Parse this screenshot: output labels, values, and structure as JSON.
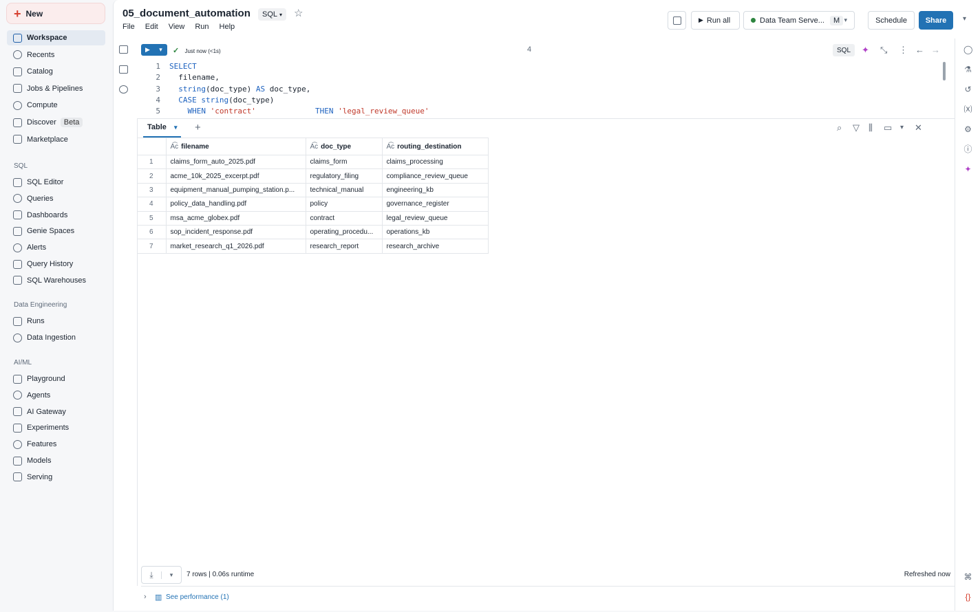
{
  "sidebar": {
    "new_label": "New",
    "items": [
      {
        "label": "Workspace",
        "icon": "workspace-icon",
        "active": true
      },
      {
        "label": "Recents",
        "icon": "clock-icon"
      },
      {
        "label": "Catalog",
        "icon": "catalog-icon"
      },
      {
        "label": "Jobs & Pipelines",
        "icon": "jobs-icon"
      },
      {
        "label": "Compute",
        "icon": "cloud-icon"
      },
      {
        "label": "Discover",
        "icon": "compass-icon",
        "badge": "Beta"
      },
      {
        "label": "Marketplace",
        "icon": "store-icon"
      }
    ],
    "sql_label": "SQL",
    "sql_items": [
      {
        "label": "SQL Editor"
      },
      {
        "label": "Queries"
      },
      {
        "label": "Dashboards"
      },
      {
        "label": "Genie Spaces"
      },
      {
        "label": "Alerts"
      },
      {
        "label": "Query History"
      },
      {
        "label": "SQL Warehouses"
      }
    ],
    "de_label": "Data Engineering",
    "de_items": [
      {
        "label": "Runs"
      },
      {
        "label": "Data Ingestion"
      }
    ],
    "ml_label": "AI/ML",
    "ml_items": [
      {
        "label": "Playground"
      },
      {
        "label": "Agents"
      },
      {
        "label": "AI Gateway"
      },
      {
        "label": "Experiments"
      },
      {
        "label": "Features"
      },
      {
        "label": "Models"
      },
      {
        "label": "Serving"
      }
    ]
  },
  "header": {
    "title": "05_document_automation",
    "language": "SQL",
    "menu": [
      "File",
      "Edit",
      "View",
      "Run",
      "Help"
    ],
    "run_all": "Run all",
    "compute_name": "Data Team Serve...",
    "compute_badge": "M",
    "schedule": "Schedule",
    "share": "Share"
  },
  "cell": {
    "status": "Just now (<1s)",
    "number": "4",
    "lang_tag": "SQL",
    "code_lines": [
      {
        "n": "1",
        "parts": [
          {
            "t": "SELECT",
            "c": "kw"
          }
        ]
      },
      {
        "n": "2",
        "parts": [
          {
            "t": "  filename,",
            "c": ""
          }
        ]
      },
      {
        "n": "3",
        "parts": [
          {
            "t": "  ",
            "c": ""
          },
          {
            "t": "string",
            "c": "kw"
          },
          {
            "t": "(doc_type) ",
            "c": ""
          },
          {
            "t": "AS",
            "c": "kw"
          },
          {
            "t": " doc_type,",
            "c": ""
          }
        ]
      },
      {
        "n": "4",
        "parts": [
          {
            "t": "  ",
            "c": ""
          },
          {
            "t": "CASE",
            "c": "kw"
          },
          {
            "t": " ",
            "c": ""
          },
          {
            "t": "string",
            "c": "kw"
          },
          {
            "t": "(doc_type)",
            "c": ""
          }
        ]
      },
      {
        "n": "5",
        "parts": [
          {
            "t": "    ",
            "c": ""
          },
          {
            "t": "WHEN",
            "c": "kw"
          },
          {
            "t": " ",
            "c": ""
          },
          {
            "t": "'contract'",
            "c": "str"
          },
          {
            "t": "             ",
            "c": ""
          },
          {
            "t": "THEN",
            "c": "kw"
          },
          {
            "t": " ",
            "c": ""
          },
          {
            "t": "'legal_review_queue'",
            "c": "str"
          }
        ]
      }
    ]
  },
  "results": {
    "tab_label": "Table",
    "columns": [
      "filename",
      "doc_type",
      "routing_destination"
    ],
    "rows": [
      [
        "1",
        "claims_form_auto_2025.pdf",
        "claims_form",
        "claims_processing"
      ],
      [
        "2",
        "acme_10k_2025_excerpt.pdf",
        "regulatory_filing",
        "compliance_review_queue"
      ],
      [
        "3",
        "equipment_manual_pumping_station.p...",
        "technical_manual",
        "engineering_kb"
      ],
      [
        "4",
        "policy_data_handling.pdf",
        "policy",
        "governance_register"
      ],
      [
        "5",
        "msa_acme_globex.pdf",
        "contract",
        "legal_review_queue"
      ],
      [
        "6",
        "sop_incident_response.pdf",
        "operating_procedu...",
        "operations_kb"
      ],
      [
        "7",
        "market_research_q1_2026.pdf",
        "research_report",
        "research_archive"
      ]
    ],
    "summary": "7 rows  |  0.06s runtime",
    "refreshed": "Refreshed now",
    "performance": "See performance (1)"
  },
  "colors": {
    "accent": "#2272b4",
    "new_icon": "#d6402f",
    "status_green": "#2e8540"
  }
}
